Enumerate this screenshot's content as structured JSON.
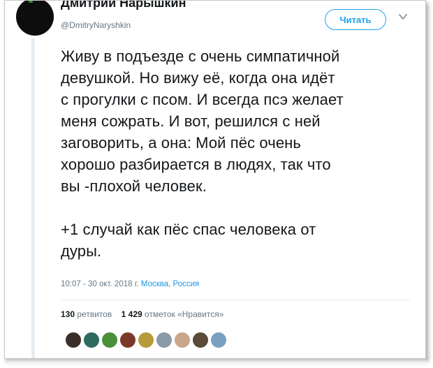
{
  "tweet": {
    "author_name": "Дмитрий Нарышкин",
    "author_handle": "@DmitryNaryshkin",
    "follow_label": "Читать",
    "text": "Живу в подъезде с очень симпатичной\nдевушкой. Но вижу её, когда она идёт\nс прогулки с псом. И всегда псэ желает\nменя сожрать. И вот, решился с ней\nзаговорить, а она: Мой пёс очень\nхорошо разбирается в людях, так что\nвы -плохой человек.\n\n+1 случай как пёс спас человека от\nдуры.",
    "timestamp": "10:07 - 30 окт. 2018 г.",
    "location": "Москва, Россия"
  },
  "stats": {
    "retweets_count": "130",
    "retweets_label": "ретвитов",
    "likes_count": "1 429",
    "likes_label": "отметок «Нравится»"
  },
  "likers": {
    "colors": [
      "#3a2f28",
      "#2f6b5e",
      "#4a8f3a",
      "#7a3a2a",
      "#b79a3a",
      "#8a9aa8",
      "#c9a78a",
      "#5a4a3a",
      "#7aa0c0"
    ]
  }
}
